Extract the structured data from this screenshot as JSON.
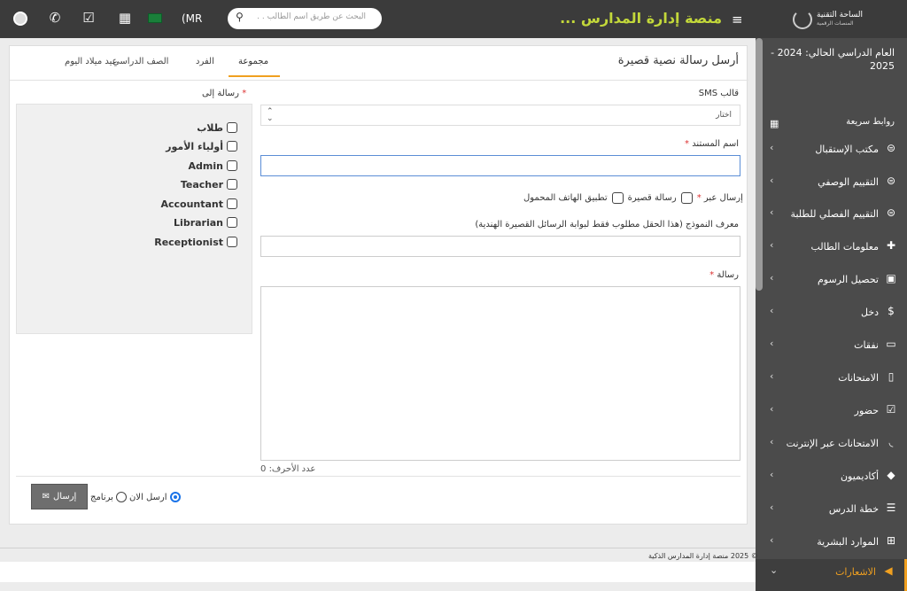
{
  "header": {
    "logo_title": "الساحة التقنية",
    "logo_subtitle": "المنصات الرقمية",
    "app_title": "منصة إدارة المدارس ...",
    "search_placeholder": "البحث عن طريق اسم الطالب . .",
    "currency": "(MR",
    "icons": [
      "hamburger-icon",
      "search-icon",
      "flag-icon",
      "calendar-icon",
      "check-square-icon",
      "whatsapp-icon",
      "user-avatar-icon"
    ]
  },
  "sidebar": {
    "academic_year": "العام الدراسي الحالي: 2024 - 2025",
    "quick_links": "روابط سريعة",
    "items": [
      {
        "label": "مكتب الإستقبال",
        "icon": "reception-icon"
      },
      {
        "label": "التقييم الوصفي",
        "icon": "evaluation-icon"
      },
      {
        "label": "التقييم الفصلي للطلبة",
        "icon": "term-evaluation-icon"
      },
      {
        "label": "معلومات الطالب",
        "icon": "user-plus-icon"
      },
      {
        "label": "تحصيل الرسوم",
        "icon": "money-icon"
      },
      {
        "label": "دخل",
        "icon": "dollar-icon"
      },
      {
        "label": "نفقات",
        "icon": "credit-card-icon"
      },
      {
        "label": "الامتحانات",
        "icon": "map-icon"
      },
      {
        "label": "حضور",
        "icon": "calendar-check-icon"
      },
      {
        "label": "الامتحانات عبر الإنترنت",
        "icon": "rss-icon"
      },
      {
        "label": "أكاديميون",
        "icon": "graduation-cap-icon"
      },
      {
        "label": "خطة الدرس",
        "icon": "list-icon"
      },
      {
        "label": "الموارد البشرية",
        "icon": "sitemap-icon"
      },
      {
        "label": "الاشعارات",
        "icon": "bullhorn-icon"
      }
    ],
    "accent": "#f0a020"
  },
  "card": {
    "title": "أرسل رسالة نصية قصيرة",
    "tabs": [
      "مجموعة",
      "الفرد",
      "الصف الدراسي",
      "عيد ميلاد اليوم"
    ],
    "active_tab": "مجموعة",
    "sms_template_label": "قالب SMS",
    "sms_template_value": "اختار",
    "document_name_label": "اسم المستند",
    "send_via_label": "إرسال عبر",
    "send_via_options": [
      "رسالة قصيرة",
      "تطبيق الهاتف المحمول"
    ],
    "template_id_label": "معرف النموذج (هذا الحقل مطلوب فقط لبوابة الرسائل القصيرة الهندية)",
    "message_label": "رسالة",
    "char_count_label": "عدد الأحرف:",
    "char_count": "0",
    "message_to_label": "رسالة إلى",
    "roles": [
      "طلاب",
      "أولياء الأمور",
      "Admin",
      "Teacher",
      "Accountant",
      "Librarian",
      "Receptionist"
    ],
    "send_now_label": "ارسل الان",
    "schedule_label": "برنامج",
    "send_button": "إرسال"
  },
  "footer": {
    "copyright": "© 2025 منصة إدارة المدارس الذكية"
  }
}
